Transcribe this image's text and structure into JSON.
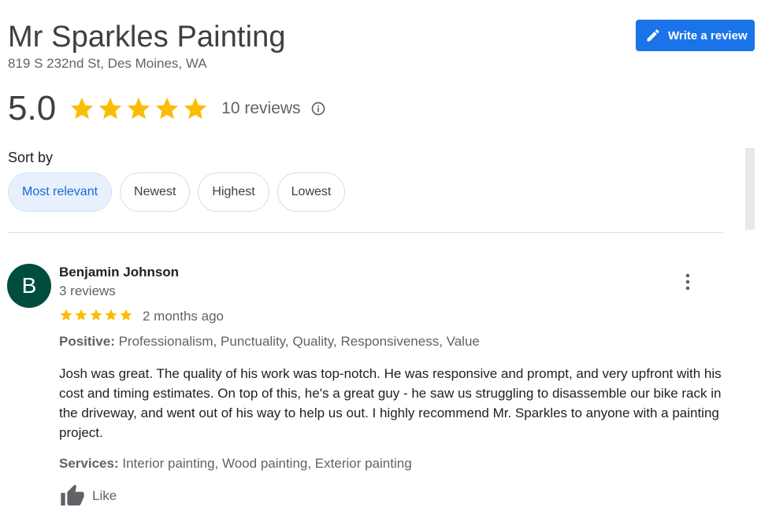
{
  "business": {
    "name": "Mr Sparkles Painting",
    "address": "819 S 232nd St, Des Moines, WA"
  },
  "actions": {
    "write_review_label": "Write a review",
    "write_review_icon": "pencil-icon"
  },
  "rating": {
    "score": "5.0",
    "stars": 5,
    "review_count_label": "10 reviews",
    "star_color": "#fbbc04"
  },
  "sort": {
    "label": "Sort by",
    "options": [
      "Most relevant",
      "Newest",
      "Highest",
      "Lowest"
    ],
    "selected": "Most relevant"
  },
  "review": {
    "avatar_letter": "B",
    "avatar_color": "#004d40",
    "author": "Benjamin Johnson",
    "author_reviews": "3 reviews",
    "stars": 5,
    "date": "2 months ago",
    "positive_label": "Positive:",
    "positive_values": "Professionalism, Punctuality, Quality, Responsiveness, Value",
    "text": "Josh was great.  The quality of his work was top-notch.  He was responsive and prompt, and very upfront with his cost and timing estimates.  On top of this, he's a great guy - he saw us struggling to disassemble our bike rack in the driveway, and went out of his way to help us out.  I highly recommend Mr. Sparkles to anyone with a painting project.",
    "services_label": "Services:",
    "services_values": "Interior painting, Wood painting, Exterior painting",
    "like_label": "Like"
  },
  "colors": {
    "accent": "#1a73e8",
    "chip_active_bg": "#e8f0fe",
    "chip_active_text": "#1967d2"
  }
}
